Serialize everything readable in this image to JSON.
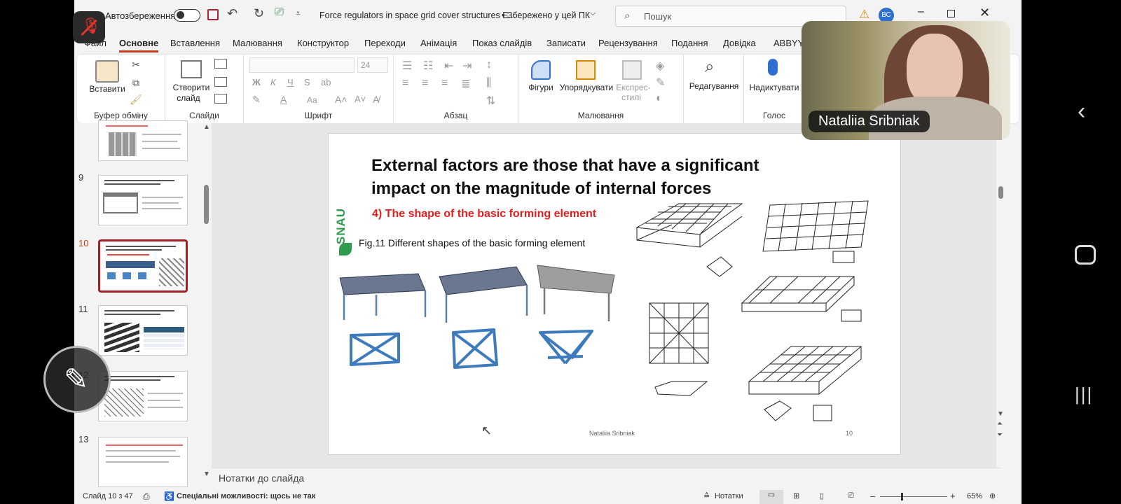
{
  "titlebar": {
    "autosave": "Автозбереження",
    "doc_title": "Force regulators in space grid cover structures E...",
    "saved": "• Збережено у цей ПК",
    "search_placeholder": "Пошук",
    "avatar": "ВС"
  },
  "tabs": [
    "Файл",
    "Основне",
    "Вставлення",
    "Малювання",
    "Конструктор",
    "Переходи",
    "Анімація",
    "Показ слайдів",
    "Записати",
    "Рецензування",
    "Подання",
    "Довідка",
    "ABBYY F"
  ],
  "ribbon": {
    "clipboard": {
      "paste": "Вставити",
      "label": "Буфер обміну"
    },
    "slides": {
      "new_slide_1": "Створити",
      "new_slide_2": "слайд",
      "label": "Слайди"
    },
    "font": {
      "size": "24",
      "label": "Шрифт",
      "bold": "Ж",
      "italic": "К",
      "underline": "Ч",
      "strike": "S",
      "shadow": "ab",
      "case": "Aa"
    },
    "paragraph": {
      "label": "Абзац"
    },
    "drawing": {
      "shapes": "Фігури",
      "arrange": "Упорядкувати",
      "quick_1": "Експрес-",
      "quick_2": "стилі",
      "label": "Малювання"
    },
    "editing": {
      "label": "Редагування"
    },
    "voice": {
      "dictate": "Надиктувати",
      "label": "Голос"
    }
  },
  "video": {
    "name": "Nataliia Sribniak"
  },
  "thumbnails": [
    {
      "num": "9"
    },
    {
      "num": "10"
    },
    {
      "num": "11"
    },
    {
      "num": "12"
    },
    {
      "num": "13"
    }
  ],
  "slide": {
    "title_line1": "External factors are those that have a significant",
    "title_line2": "impact on the magnitude of internal forces",
    "subtitle": "4) The shape of the basic forming element",
    "logo": "SNAU",
    "figure_caption": "Fig.11 Different shapes of the basic forming element",
    "footer_author": "Nataliia Sribniak",
    "page_number": "10"
  },
  "notes_placeholder": "Нотатки до слайда",
  "status": {
    "slide_count": "Слайд 10 з 47",
    "accessibility": "Спеціальні можливості: щось не так",
    "notes": "Нотатки",
    "zoom": "65%"
  },
  "colors": {
    "title_red": "#e02020",
    "accent": "#c43e1c",
    "snau_green": "#2e9b4f",
    "blue_elem": "#4a86c5"
  }
}
